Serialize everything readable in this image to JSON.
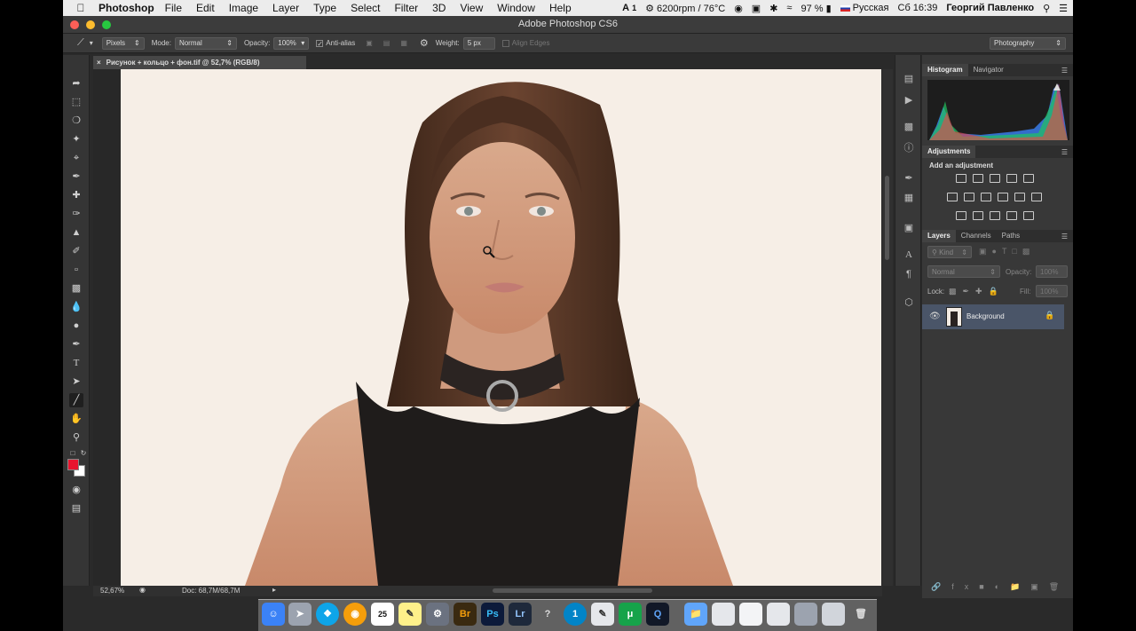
{
  "menubar": {
    "app": "Photoshop",
    "items": [
      "File",
      "Edit",
      "Image",
      "Layer",
      "Type",
      "Select",
      "Filter",
      "3D",
      "View",
      "Window",
      "Help"
    ],
    "status": {
      "cpu": "6200rpm / 76°C",
      "battery": "97 %",
      "input_lang": "Русская",
      "datetime": "Сб 16:39",
      "user": "Георгий Павленко",
      "ai_badge": "1"
    }
  },
  "window": {
    "title": "Adobe Photoshop CS6"
  },
  "options": {
    "mode_select": "Pixels",
    "mode_label": "Mode:",
    "blend": "Normal",
    "opacity_label": "Opacity:",
    "opacity": "100%",
    "antialias": "Anti-alias",
    "weight_label": "Weight:",
    "weight": "5 px",
    "align_edges": "Align Edges",
    "workspace": "Photography"
  },
  "document": {
    "tab": "Рисунок + кольцо + фон.tif @ 52,7% (RGB/8)",
    "zoom": "52,67%",
    "doc_size": "Doc: 68,7M/68,7M"
  },
  "panels": {
    "histogram_tabs": [
      "Histogram",
      "Navigator"
    ],
    "adjustments_tab": "Adjustments",
    "add_adjustment": "Add an adjustment",
    "layers_tabs": [
      "Layers",
      "Channels",
      "Paths"
    ],
    "kind": "Kind",
    "blend": "Normal",
    "opacity_label": "Opacity:",
    "opacity": "100%",
    "lock_label": "Lock:",
    "fill_label": "Fill:",
    "fill": "100%",
    "layer_name": "Background"
  },
  "colors": {
    "foreground": "#e8142e",
    "background": "#ffffff",
    "accent": "#4a5568"
  }
}
